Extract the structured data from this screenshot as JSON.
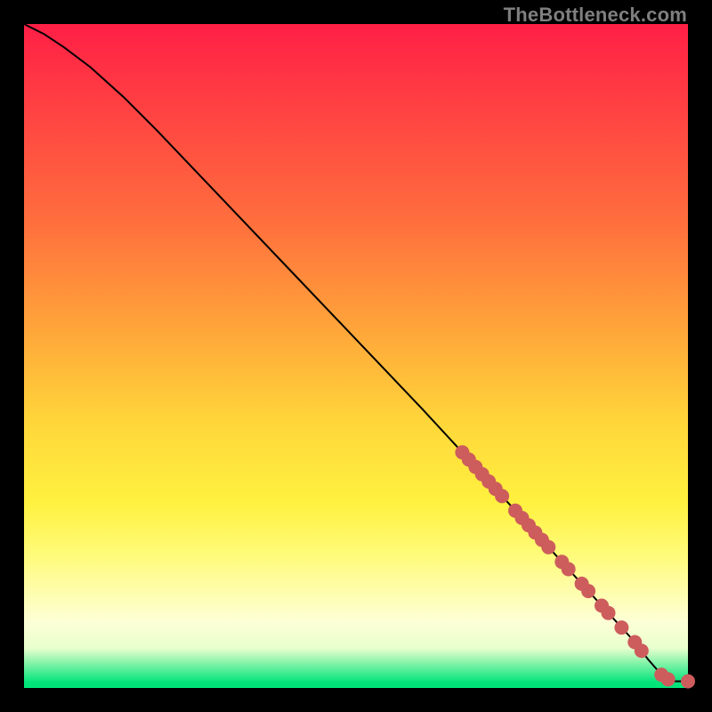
{
  "watermark": "TheBottleneck.com",
  "colors": {
    "dot": "#cd5c5c",
    "line": "#000000"
  },
  "chart_data": {
    "type": "line",
    "title": "",
    "xlabel": "",
    "ylabel": "",
    "xlim": [
      0,
      100
    ],
    "ylim": [
      0,
      100
    ],
    "grid": false,
    "legend": false,
    "series": [
      {
        "name": "curve",
        "x": [
          0,
          3,
          6,
          10,
          15,
          20,
          30,
          40,
          50,
          60,
          66,
          68,
          70,
          72,
          74,
          76,
          78,
          80,
          82,
          84,
          86,
          88,
          90,
          92,
          94,
          96,
          98,
          100
        ],
        "y": [
          100,
          98.5,
          96.5,
          93.5,
          89,
          84,
          73.5,
          63,
          52.5,
          42,
          35.5,
          33.3,
          31.1,
          28.9,
          26.7,
          24.5,
          22.3,
          20.1,
          17.9,
          15.7,
          13.5,
          11.3,
          9.1,
          6.9,
          4.3,
          2.0,
          1.0,
          1.0
        ]
      }
    ],
    "points": [
      {
        "x": 66,
        "y": 35.5
      },
      {
        "x": 67,
        "y": 34.4
      },
      {
        "x": 68,
        "y": 33.3
      },
      {
        "x": 69,
        "y": 32.2
      },
      {
        "x": 70,
        "y": 31.1
      },
      {
        "x": 71,
        "y": 30.0
      },
      {
        "x": 72,
        "y": 28.9
      },
      {
        "x": 74,
        "y": 26.7
      },
      {
        "x": 75,
        "y": 25.6
      },
      {
        "x": 76,
        "y": 24.5
      },
      {
        "x": 77,
        "y": 23.4
      },
      {
        "x": 78,
        "y": 22.3
      },
      {
        "x": 79,
        "y": 21.2
      },
      {
        "x": 81,
        "y": 19.0
      },
      {
        "x": 82,
        "y": 17.9
      },
      {
        "x": 84,
        "y": 15.7
      },
      {
        "x": 85,
        "y": 14.6
      },
      {
        "x": 87,
        "y": 12.4
      },
      {
        "x": 88,
        "y": 11.3
      },
      {
        "x": 90,
        "y": 9.1
      },
      {
        "x": 92,
        "y": 6.9
      },
      {
        "x": 93,
        "y": 5.6
      },
      {
        "x": 96,
        "y": 2.0
      },
      {
        "x": 97,
        "y": 1.3
      },
      {
        "x": 100,
        "y": 1.0
      }
    ]
  }
}
